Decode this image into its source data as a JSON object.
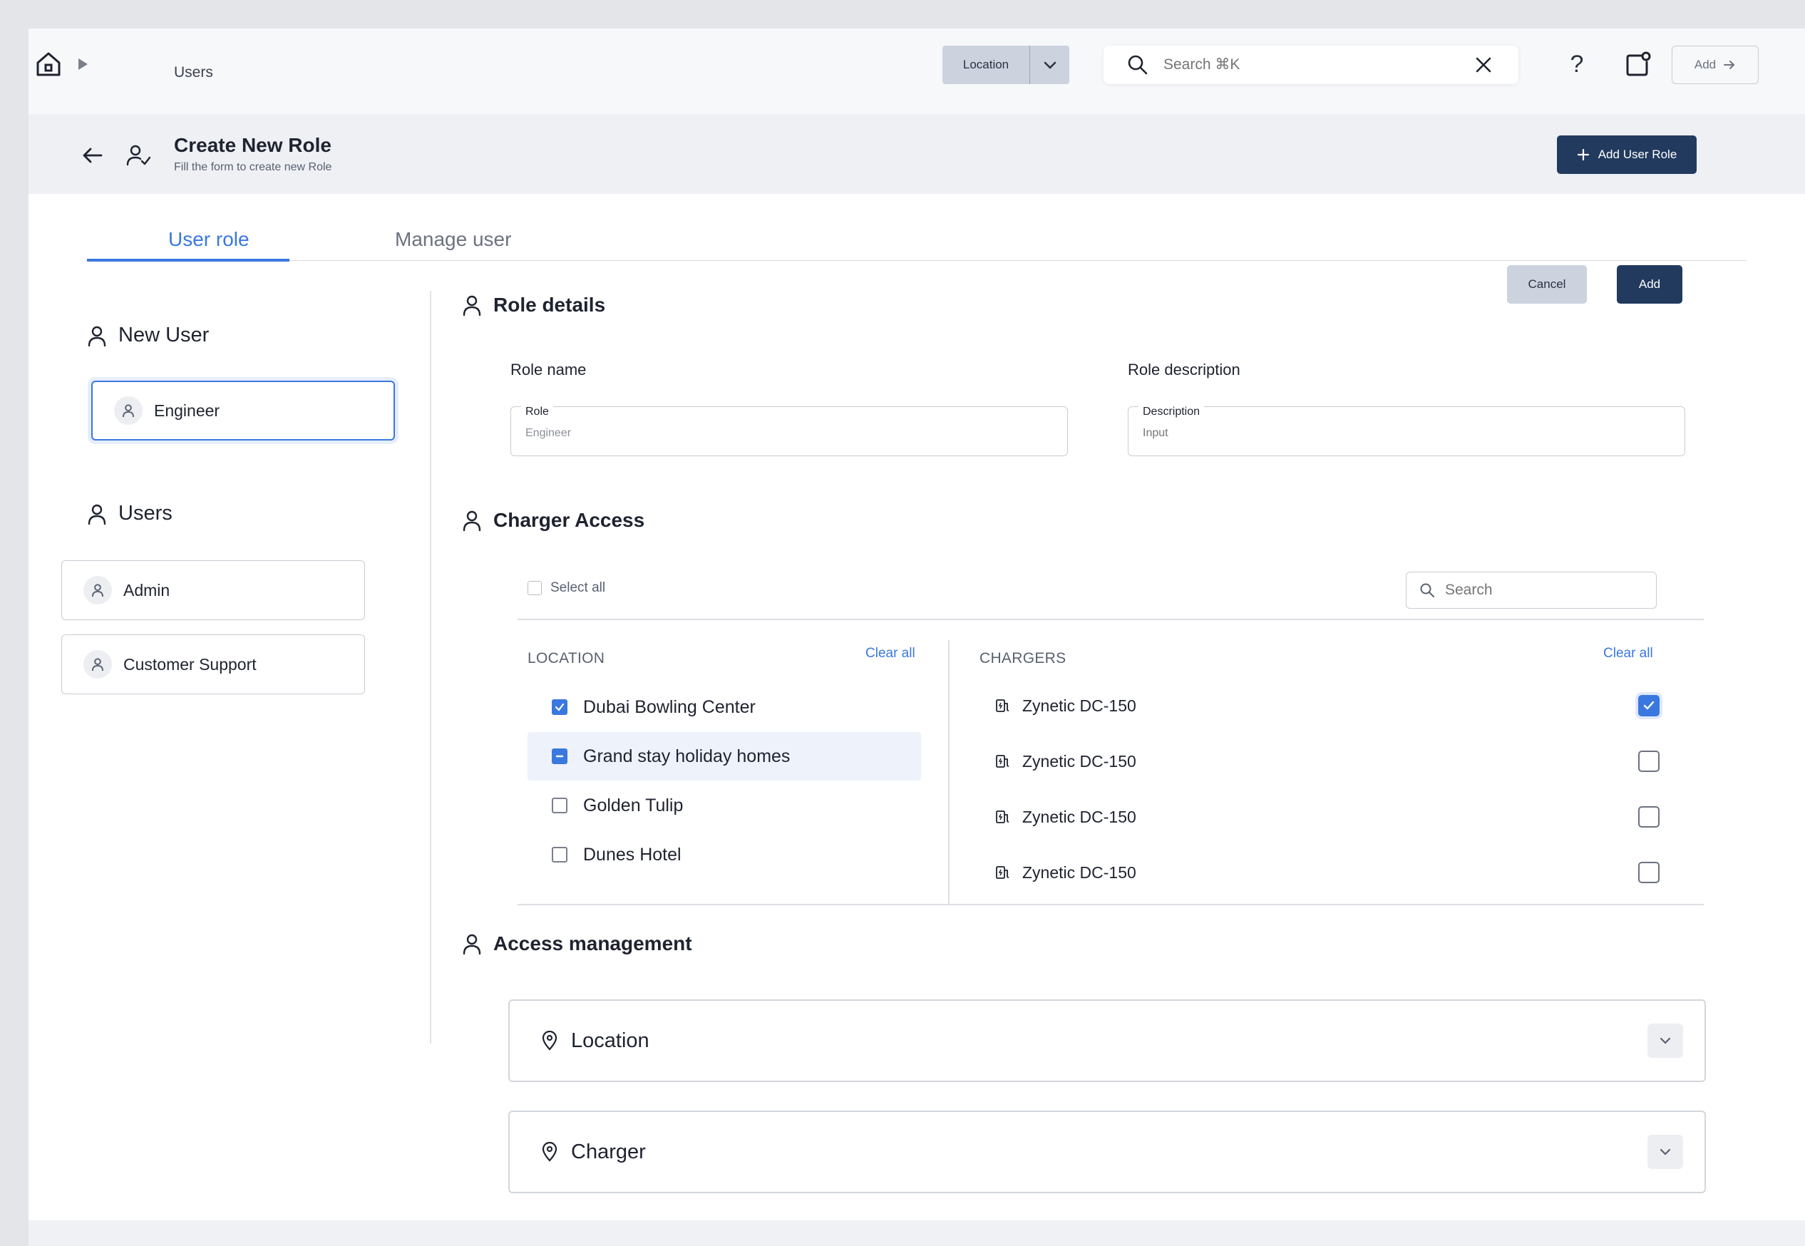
{
  "topbar": {
    "breadcrumb": "Users",
    "location_select": "Location",
    "search_placeholder": "Search ⌘K",
    "help": "?",
    "add_label": "Add"
  },
  "header": {
    "title": "Create New Role",
    "subtitle": "Fill the form to create new Role",
    "add_role_label": "Add User Role"
  },
  "tabs": [
    {
      "label": "User role",
      "active": true
    },
    {
      "label": "Manage user",
      "active": false
    }
  ],
  "actions": {
    "cancel": "Cancel",
    "add": "Add"
  },
  "sidebar": {
    "new_user_title": "New User",
    "new_user_value": "Engineer",
    "users_title": "Users",
    "users": [
      "Admin",
      "Customer Support"
    ]
  },
  "role_details": {
    "title": "Role details",
    "role_name_label": "Role name",
    "role_legend": "Role",
    "role_value": "Engineer",
    "role_description_label": "Role description",
    "description_legend": "Description",
    "description_placeholder": "Input"
  },
  "charger_access": {
    "title": "Charger Access",
    "select_all": "Select all",
    "search_placeholder": "Search",
    "location_header": "LOCATION",
    "chargers_header": "CHARGERS",
    "clear_all": "Clear all",
    "locations": [
      {
        "name": "Dubai Bowling Center",
        "state": "checked"
      },
      {
        "name": "Grand stay holiday homes",
        "state": "indeterminate"
      },
      {
        "name": "Golden Tulip",
        "state": "unchecked"
      },
      {
        "name": "Dunes Hotel",
        "state": "unchecked"
      }
    ],
    "chargers": [
      {
        "name": "Zynetic DC-150",
        "checked": true
      },
      {
        "name": "Zynetic DC-150",
        "checked": false
      },
      {
        "name": "Zynetic DC-150",
        "checked": false
      },
      {
        "name": "Zynetic DC-150",
        "checked": false
      }
    ]
  },
  "access_management": {
    "title": "Access management",
    "sections": [
      "Location",
      "Charger"
    ]
  },
  "colors": {
    "accent": "#3a78e0",
    "primary_dark": "#223a5e",
    "header_bg": "#eef0f4"
  }
}
